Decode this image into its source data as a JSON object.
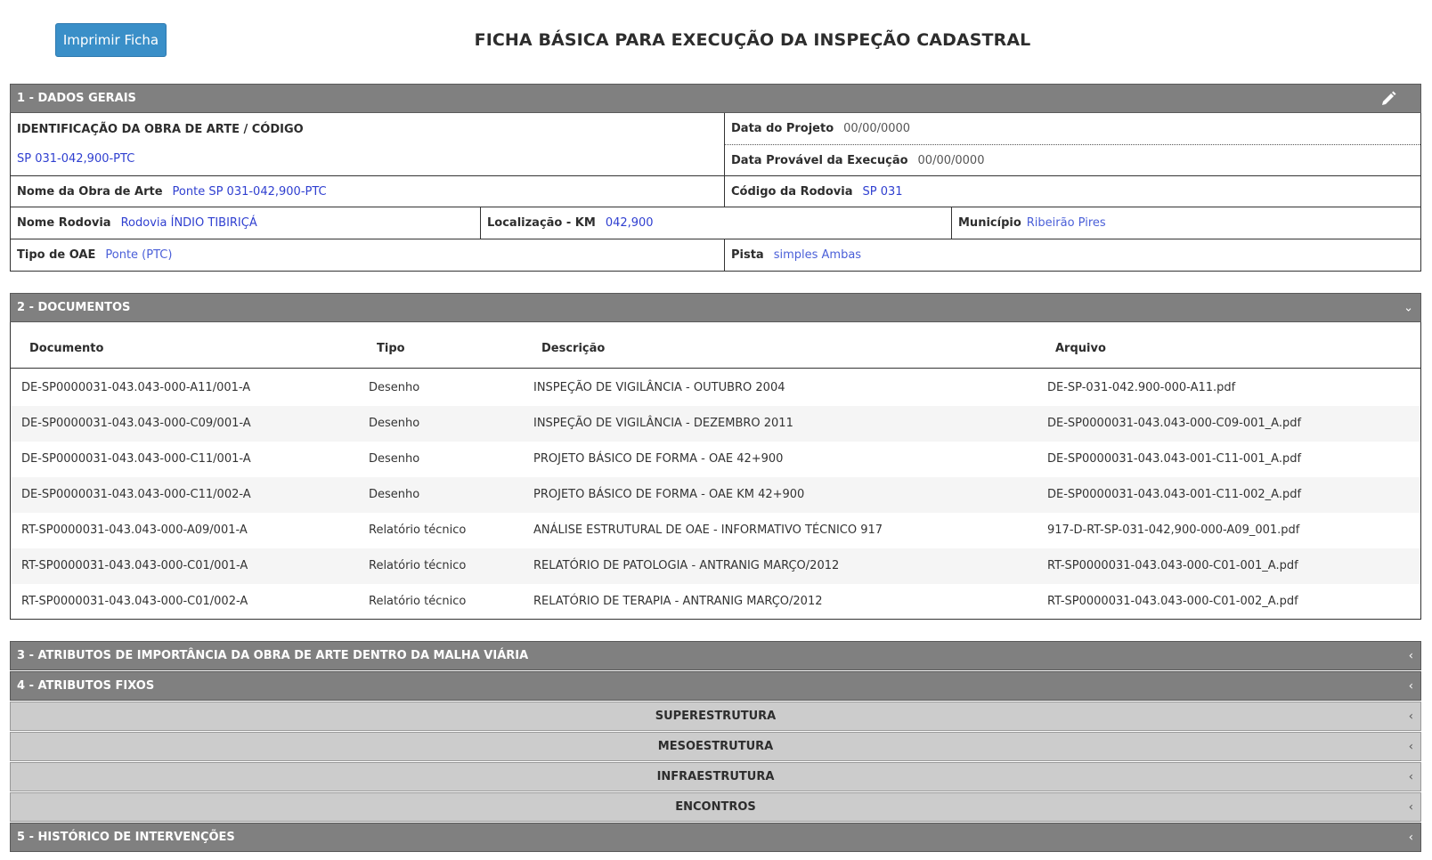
{
  "header": {
    "print_button": "Imprimir Ficha",
    "title": "FICHA BÁSICA PARA EXECUÇÃO DA INSPEÇÃO CADASTRAL"
  },
  "sections": {
    "s1": "1 - DADOS GERAIS",
    "s2": "2 - DOCUMENTOS",
    "s3": "3 - ATRIBUTOS DE IMPORTÂNCIA DA OBRA DE ARTE DENTRO DA MALHA VIÁRIA",
    "s4": "4 - ATRIBUTOS FIXOS",
    "s5": "5 - HISTÓRICO DE INTERVENÇÕES"
  },
  "subsections": {
    "superestrutura": "SUPERESTRUTURA",
    "mesoestrutura": "MESOESTRUTURA",
    "infraestrutura": "INFRAESTRUTURA",
    "encontros": "ENCONTROS"
  },
  "dados_gerais": {
    "identificacao_label": "IDENTIFICAÇÃO DA OBRA DE ARTE / CÓDIGO",
    "identificacao_value": "SP 031-042,900-PTC",
    "data_projeto_label": "Data do Projeto",
    "data_projeto_value": "00/00/0000",
    "data_execucao_label": "Data Provável da Execução",
    "data_execucao_value": "00/00/0000",
    "nome_obra_label": "Nome da Obra de Arte",
    "nome_obra_value": "Ponte SP 031-042,900-PTC",
    "codigo_rodovia_label": "Código da Rodovia",
    "codigo_rodovia_value": "SP 031",
    "nome_rodovia_label": "Nome Rodovia",
    "nome_rodovia_value": "Rodovia ÍNDIO TIBIRIÇÁ",
    "localizacao_label": "Localização - KM",
    "localizacao_value": "042,900",
    "municipio_label": "Município",
    "municipio_value": "Ribeirão Pires",
    "tipo_oae_label": "Tipo de OAE",
    "tipo_oae_value": "Ponte (PTC)",
    "pista_label": "Pista",
    "pista_value": "simples Ambas"
  },
  "documentos": {
    "headers": [
      "Documento",
      "Tipo",
      "Descrição",
      "Arquivo"
    ],
    "rows": [
      [
        "DE-SP0000031-043.043-000-A11/001-A",
        "Desenho",
        "INSPEÇÃO DE VIGILÂNCIA - OUTUBRO 2004",
        "DE-SP-031-042.900-000-A11.pdf"
      ],
      [
        "DE-SP0000031-043.043-000-C09/001-A",
        "Desenho",
        "INSPEÇÃO DE VIGILÂNCIA - DEZEMBRO 2011",
        "DE-SP0000031-043.043-000-C09-001_A.pdf"
      ],
      [
        "DE-SP0000031-043.043-000-C11/001-A",
        "Desenho",
        "PROJETO BÁSICO DE FORMA - OAE 42+900",
        "DE-SP0000031-043.043-001-C11-001_A.pdf"
      ],
      [
        "DE-SP0000031-043.043-000-C11/002-A",
        "Desenho",
        "PROJETO BÁSICO DE FORMA - OAE KM 42+900",
        "DE-SP0000031-043.043-001-C11-002_A.pdf"
      ],
      [
        "RT-SP0000031-043.043-000-A09/001-A",
        "Relatório técnico",
        "ANÁLISE ESTRUTURAL DE OAE - INFORMATIVO TÉCNICO 917",
        "917-D-RT-SP-031-042,900-000-A09_001.pdf"
      ],
      [
        "RT-SP0000031-043.043-000-C01/001-A",
        "Relatório técnico",
        "RELATÓRIO DE PATOLOGIA - ANTRANIG MARÇO/2012",
        "RT-SP0000031-043.043-000-C01-001_A.pdf"
      ],
      [
        "RT-SP0000031-043.043-000-C01/002-A",
        "Relatório técnico",
        "RELATÓRIO DE TERAPIA - ANTRANIG MARÇO/2012",
        "RT-SP0000031-043.043-000-C01-002_A.pdf"
      ]
    ]
  },
  "icons": {
    "edit": "pencil-icon",
    "expanded": "chevron-down-icon",
    "collapsed": "chevron-left-icon"
  },
  "colors": {
    "button": "#3a8fc8",
    "section_bar": "#808080",
    "sub_bar": "#cccccc",
    "value_text": "#2f3fd0"
  }
}
